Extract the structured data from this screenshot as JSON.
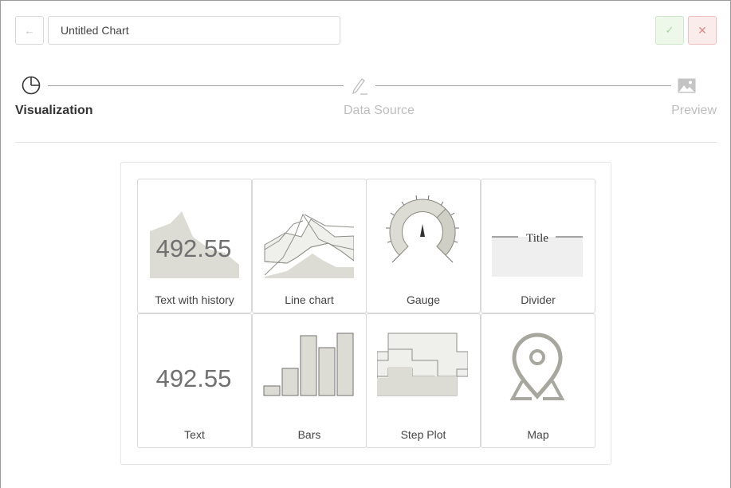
{
  "header": {
    "back_icon": "arrow-left-icon",
    "title_value": "Untitled Chart",
    "confirm_icon": "check-icon",
    "cancel_icon": "close-icon"
  },
  "steps": [
    {
      "label": "Visualization",
      "icon": "pie-chart-icon",
      "state": "active"
    },
    {
      "label": "Data Source",
      "icon": "pencil-icon",
      "state": "inactive"
    },
    {
      "label": "Preview",
      "icon": "image-icon",
      "state": "inactive"
    }
  ],
  "visualizations": [
    {
      "label": "Text with history",
      "icon": "text-with-history-icon",
      "sample_value": "492.55"
    },
    {
      "label": "Line chart",
      "icon": "line-chart-icon"
    },
    {
      "label": "Gauge",
      "icon": "gauge-icon"
    },
    {
      "label": "Divider",
      "icon": "divider-icon",
      "sample_text": "Title"
    },
    {
      "label": "Text",
      "icon": "text-icon",
      "sample_value": "492.55"
    },
    {
      "label": "Bars",
      "icon": "bars-icon"
    },
    {
      "label": "Step Plot",
      "icon": "step-plot-icon"
    },
    {
      "label": "Map",
      "icon": "map-pin-icon"
    }
  ],
  "colors": {
    "illustration_fill": "#dcdcd4",
    "illustration_stroke": "#8a8a80",
    "confirm_bg": "#eef8ea",
    "cancel_bg": "#fbecec"
  }
}
